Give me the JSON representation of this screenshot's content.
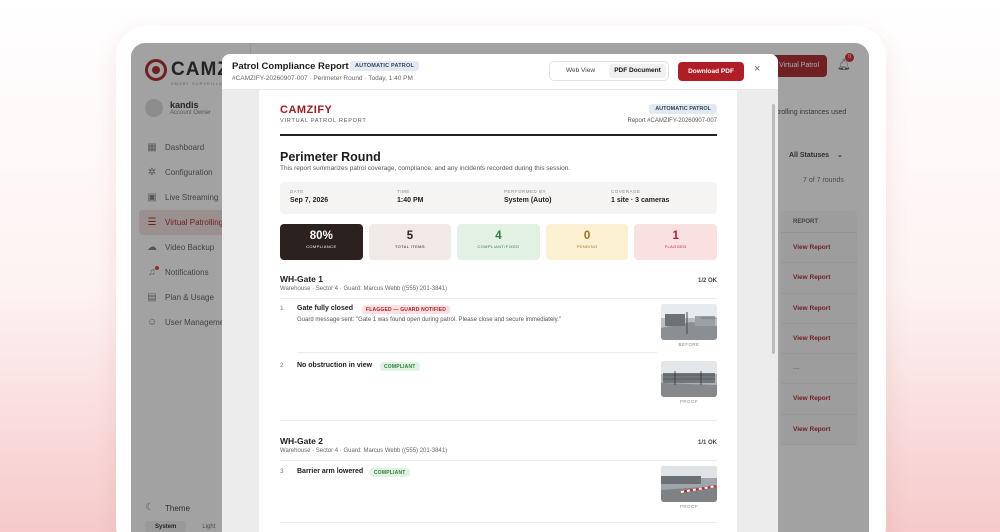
{
  "app": {
    "logo": "CAMZ",
    "logo_sub": "SMART SURVEILLANCE",
    "account": {
      "name": "kandis",
      "role": "Account Owner"
    },
    "nav": [
      {
        "label": "Dashboard",
        "icon": "grid-icon"
      },
      {
        "label": "Configuration",
        "icon": "gear-icon"
      },
      {
        "label": "Live Streaming",
        "icon": "video-icon"
      },
      {
        "label": "Virtual Patrolling",
        "icon": "list-icon",
        "active": true
      },
      {
        "label": "Video Backup",
        "icon": "cloud-icon"
      },
      {
        "label": "Notifications",
        "icon": "bell-icon"
      },
      {
        "label": "Plan & Usage",
        "icon": "document-icon"
      },
      {
        "label": "User Management",
        "icon": "user-icon"
      }
    ],
    "theme_label": "Theme",
    "theme_options": [
      "System",
      "Light"
    ],
    "top_button": "Virtual Patrol",
    "notification_count": "0",
    "usage_text": "trolling instances used",
    "status_filter": "All Statuses",
    "rounds_count": "7 of 7 rounds",
    "table_header": "REPORT",
    "table_rows": [
      "View Report",
      "View Report",
      "View Report",
      "View Report",
      "—",
      "View Report",
      "View Report"
    ]
  },
  "modal": {
    "title": "Patrol Compliance Report",
    "badge": "AUTOMATIC PATROL",
    "subtitle": "#CAMZIFY-20260907-007 · Perimeter Round · Today, 1:40 PM",
    "view_options": [
      "Web View",
      "PDF Document"
    ],
    "selected_view": "PDF Document",
    "download_label": "Download PDF",
    "close_symbol": "×"
  },
  "report": {
    "brand": "CAMZIFY",
    "brand_sub": "VIRTUAL PATROL REPORT",
    "badge": "AUTOMATIC PATROL",
    "ref": "Report #CAMZIFY-20260907-007",
    "title": "Perimeter Round",
    "description": "This report summarizes patrol coverage, compliance, and any incidents recorded during this session.",
    "meta": [
      {
        "label": "DATE",
        "value": "Sep 7, 2026"
      },
      {
        "label": "TIME",
        "value": "1:40 PM"
      },
      {
        "label": "PERFORMED BY",
        "value": "System (Auto)"
      },
      {
        "label": "COVERAGE",
        "value": "1 site · 3 cameras"
      }
    ],
    "stats": [
      {
        "value": "80%",
        "label": "COMPLIANCE"
      },
      {
        "value": "5",
        "label": "TOTAL ITEMS"
      },
      {
        "value": "4",
        "label": "COMPLIANT/FIXED"
      },
      {
        "value": "0",
        "label": "PENDING"
      },
      {
        "value": "1",
        "label": "FLAGGED"
      }
    ],
    "gates": [
      {
        "name": "WH-Gate 1",
        "location": "Warehouse · Sector 4 · Guard: Marcus Webb ((555) 201-3841)",
        "ok": "1/2 OK",
        "items": [
          {
            "num": "1",
            "title": "Gate fully closed",
            "tag": "FLAGGED — GUARD NOTIFIED",
            "message": "Guard message sent: \"Gate 1 was found open during patrol. Please close and secure immediately.\"",
            "caption": "BEFORE"
          },
          {
            "num": "2",
            "title": "No obstruction in view",
            "tag": "COMPLIANT",
            "caption": "PROOF"
          }
        ]
      },
      {
        "name": "WH-Gate 2",
        "location": "Warehouse · Sector 4 · Guard: Marcus Webb ((555) 201-3841)",
        "ok": "1/1 OK",
        "items": [
          {
            "num": "3",
            "title": "Barrier arm lowered",
            "tag": "COMPLIANT",
            "caption": "PROOF"
          }
        ]
      }
    ]
  }
}
